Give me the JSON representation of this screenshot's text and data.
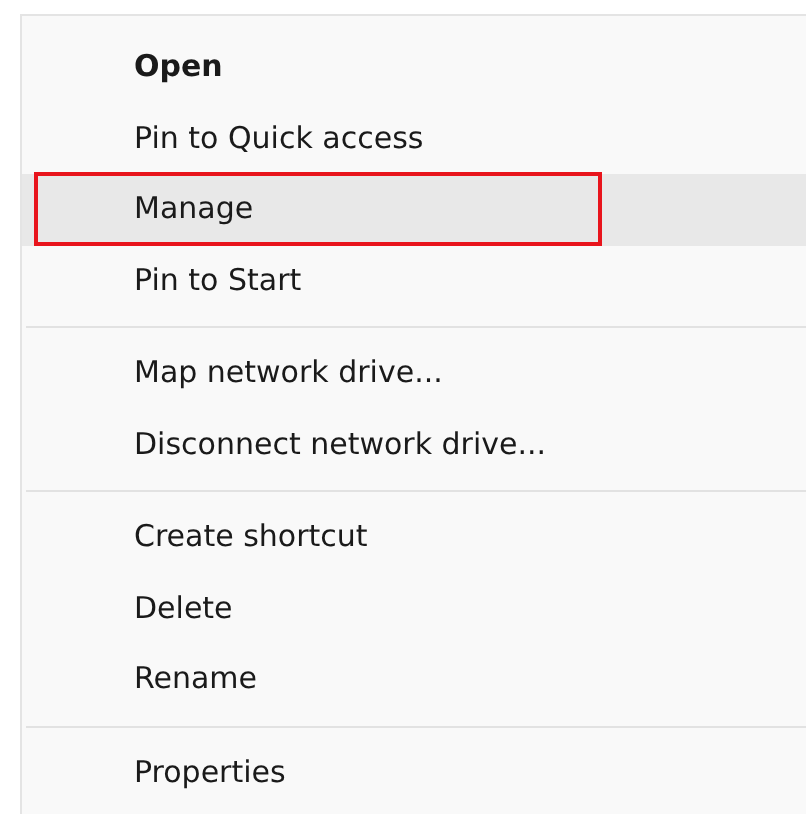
{
  "context_menu": {
    "groups": [
      {
        "items": [
          {
            "label": "Open",
            "default": true,
            "hovered": false,
            "outlined": false
          },
          {
            "label": "Pin to Quick access",
            "default": false,
            "hovered": false,
            "outlined": false
          },
          {
            "label": "Manage",
            "default": false,
            "hovered": true,
            "outlined": true
          },
          {
            "label": "Pin to Start",
            "default": false,
            "hovered": false,
            "outlined": false
          }
        ]
      },
      {
        "items": [
          {
            "label": "Map network drive...",
            "default": false,
            "hovered": false,
            "outlined": false
          },
          {
            "label": "Disconnect network drive...",
            "default": false,
            "hovered": false,
            "outlined": false
          }
        ]
      },
      {
        "items": [
          {
            "label": "Create shortcut",
            "default": false,
            "hovered": false,
            "outlined": false
          },
          {
            "label": "Delete",
            "default": false,
            "hovered": false,
            "outlined": false
          },
          {
            "label": "Rename",
            "default": false,
            "hovered": false,
            "outlined": false
          }
        ]
      },
      {
        "items": [
          {
            "label": "Properties",
            "default": false,
            "hovered": false,
            "outlined": false
          }
        ]
      }
    ]
  }
}
